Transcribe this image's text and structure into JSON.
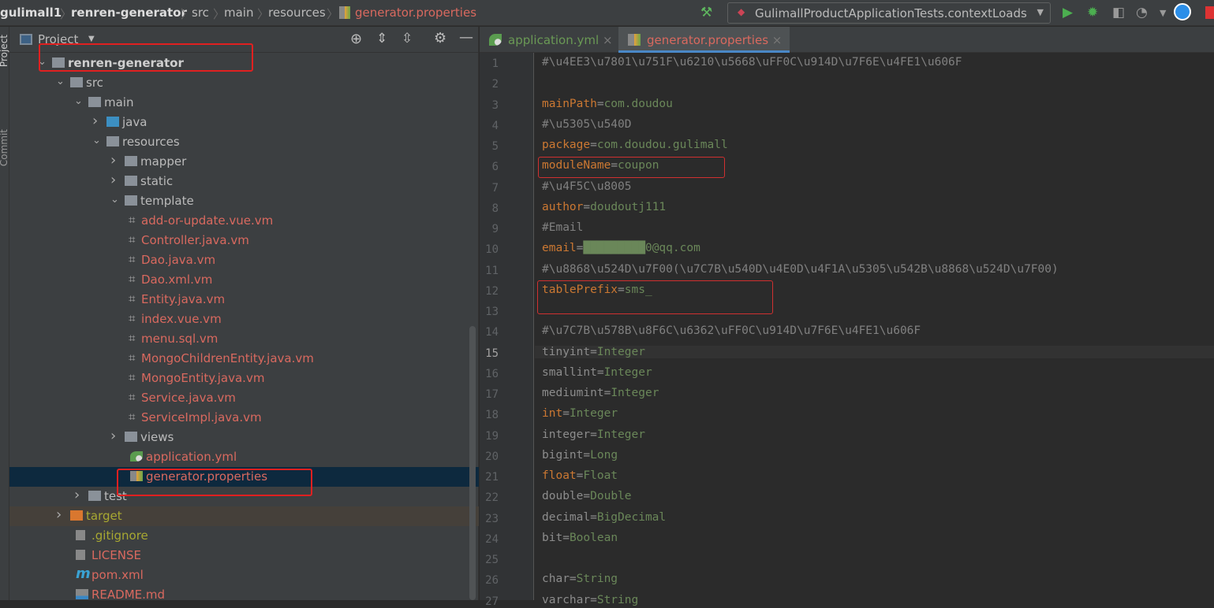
{
  "breadcrumb": [
    "gulimall1",
    "renren-generator",
    "src",
    "main",
    "resources",
    "generator.properties"
  ],
  "run_config": "GulimallProductApplicationTests.contextLoads",
  "side_strip": {
    "top": "Project",
    "mid": "Commit"
  },
  "panel": {
    "title": "Project"
  },
  "tree": [
    {
      "label": "renren-generator",
      "level": 0,
      "type": "module",
      "arrow": "open",
      "color": "#cfcfcf",
      "bold": true
    },
    {
      "label": "src",
      "level": 1,
      "type": "folder",
      "arrow": "open",
      "color": "#bbbbbb"
    },
    {
      "label": "main",
      "level": 2,
      "type": "folder",
      "arrow": "open",
      "color": "#bbbbbb"
    },
    {
      "label": "java",
      "level": 3,
      "type": "src-folder",
      "arrow": "closed",
      "color": "#bbbbbb"
    },
    {
      "label": "resources",
      "level": 3,
      "type": "res-folder",
      "arrow": "open",
      "color": "#bbbbbb"
    },
    {
      "label": "mapper",
      "level": 4,
      "type": "folder",
      "arrow": "closed",
      "color": "#bbbbbb"
    },
    {
      "label": "static",
      "level": 4,
      "type": "folder",
      "arrow": "closed",
      "color": "#bbbbbb"
    },
    {
      "label": "template",
      "level": 4,
      "type": "folder",
      "arrow": "open",
      "color": "#bbbbbb"
    },
    {
      "label": "add-or-update.vue.vm",
      "level": 5,
      "type": "vm",
      "color": "#d9695f"
    },
    {
      "label": "Controller.java.vm",
      "level": 5,
      "type": "vm",
      "color": "#d9695f"
    },
    {
      "label": "Dao.java.vm",
      "level": 5,
      "type": "vm",
      "color": "#d9695f"
    },
    {
      "label": "Dao.xml.vm",
      "level": 5,
      "type": "vm",
      "color": "#d9695f"
    },
    {
      "label": "Entity.java.vm",
      "level": 5,
      "type": "vm",
      "color": "#d9695f"
    },
    {
      "label": "index.vue.vm",
      "level": 5,
      "type": "vm",
      "color": "#d9695f"
    },
    {
      "label": "menu.sql.vm",
      "level": 5,
      "type": "vm",
      "color": "#d9695f"
    },
    {
      "label": "MongoChildrenEntity.java.vm",
      "level": 5,
      "type": "vm",
      "color": "#d9695f"
    },
    {
      "label": "MongoEntity.java.vm",
      "level": 5,
      "type": "vm",
      "color": "#d9695f"
    },
    {
      "label": "Service.java.vm",
      "level": 5,
      "type": "vm",
      "color": "#d9695f"
    },
    {
      "label": "ServiceImpl.java.vm",
      "level": 5,
      "type": "vm",
      "color": "#d9695f"
    },
    {
      "label": "views",
      "level": 4,
      "type": "folder",
      "arrow": "closed",
      "color": "#bbbbbb"
    },
    {
      "label": "application.yml",
      "level": 4,
      "type": "yml",
      "color": "#d9695f"
    },
    {
      "label": "generator.properties",
      "level": 4,
      "type": "props",
      "color": "#d9695f",
      "selected": true
    },
    {
      "label": "test",
      "level": 2,
      "type": "folder",
      "arrow": "closed",
      "color": "#bbbbbb"
    },
    {
      "label": "target",
      "level": 1,
      "type": "excluded",
      "arrow": "closed",
      "color": "#a8a832",
      "excluded": true
    },
    {
      "label": ".gitignore",
      "level": 1,
      "type": "file",
      "color": "#a8a832"
    },
    {
      "label": "LICENSE",
      "level": 1,
      "type": "file",
      "color": "#d9695f"
    },
    {
      "label": "pom.xml",
      "level": 1,
      "type": "maven",
      "color": "#d9695f"
    },
    {
      "label": "README.md",
      "level": 1,
      "type": "md",
      "color": "#d9695f"
    }
  ],
  "tabs": [
    {
      "label": "application.yml",
      "active": false
    },
    {
      "label": "generator.properties",
      "active": true
    }
  ],
  "current_line": 15,
  "code": [
    [
      [
        "c",
        "#\\u4EE3\\u7801\\u751F\\u6210\\u5668\\uFF0C\\u914D\\u7F6E\\u4FE1\\u606F"
      ]
    ],
    [],
    [
      [
        "k",
        "mainPath"
      ],
      [
        "g",
        "="
      ],
      [
        "v",
        "com.doudou"
      ]
    ],
    [
      [
        "c",
        "#\\u5305\\u540D"
      ]
    ],
    [
      [
        "k",
        "package"
      ],
      [
        "g",
        "="
      ],
      [
        "v",
        "com.doudou.gulimall"
      ]
    ],
    [
      [
        "k",
        "moduleName"
      ],
      [
        "g",
        "="
      ],
      [
        "v",
        "coupon"
      ]
    ],
    [
      [
        "c",
        "#\\u4F5C\\u8005"
      ]
    ],
    [
      [
        "k",
        "author"
      ],
      [
        "g",
        "="
      ],
      [
        "v",
        "doudoutj111"
      ]
    ],
    [
      [
        "c",
        "#Email"
      ]
    ],
    [
      [
        "k",
        "email"
      ],
      [
        "g",
        "="
      ],
      [
        "v",
        "█████████0@qq.com"
      ]
    ],
    [
      [
        "c",
        "#\\u8868\\u524D\\u7F00(\\u7C7B\\u540D\\u4E0D\\u4F1A\\u5305\\u542B\\u8868\\u524D\\u7F00)"
      ]
    ],
    [
      [
        "k",
        "tablePrefix"
      ],
      [
        "g",
        "="
      ],
      [
        "v",
        "sms_"
      ]
    ],
    [],
    [
      [
        "c",
        "#\\u7C7B\\u578B\\u8F6C\\u6362\\uFF0C\\u914D\\u7F6E\\u4FE1\\u606F"
      ]
    ],
    [
      [
        "g",
        "tinyint"
      ],
      [
        "g",
        "="
      ],
      [
        "v",
        "Integer"
      ]
    ],
    [
      [
        "g",
        "smallint"
      ],
      [
        "g",
        "="
      ],
      [
        "v",
        "Integer"
      ]
    ],
    [
      [
        "g",
        "mediumint"
      ],
      [
        "g",
        "="
      ],
      [
        "v",
        "Integer"
      ]
    ],
    [
      [
        "k",
        "int"
      ],
      [
        "g",
        "="
      ],
      [
        "v",
        "Integer"
      ]
    ],
    [
      [
        "g",
        "integer"
      ],
      [
        "g",
        "="
      ],
      [
        "v",
        "Integer"
      ]
    ],
    [
      [
        "g",
        "bigint"
      ],
      [
        "g",
        "="
      ],
      [
        "v",
        "Long"
      ]
    ],
    [
      [
        "k",
        "float"
      ],
      [
        "g",
        "="
      ],
      [
        "v",
        "Float"
      ]
    ],
    [
      [
        "g",
        "double"
      ],
      [
        "g",
        "="
      ],
      [
        "v",
        "Double"
      ]
    ],
    [
      [
        "g",
        "decimal"
      ],
      [
        "g",
        "="
      ],
      [
        "v",
        "BigDecimal"
      ]
    ],
    [
      [
        "g",
        "bit"
      ],
      [
        "g",
        "="
      ],
      [
        "v",
        "Boolean"
      ]
    ],
    [],
    [
      [
        "g",
        "char"
      ],
      [
        "g",
        "="
      ],
      [
        "v",
        "String"
      ]
    ],
    [
      [
        "g",
        "varchar"
      ],
      [
        "g",
        "="
      ],
      [
        "v",
        "String"
      ]
    ]
  ]
}
